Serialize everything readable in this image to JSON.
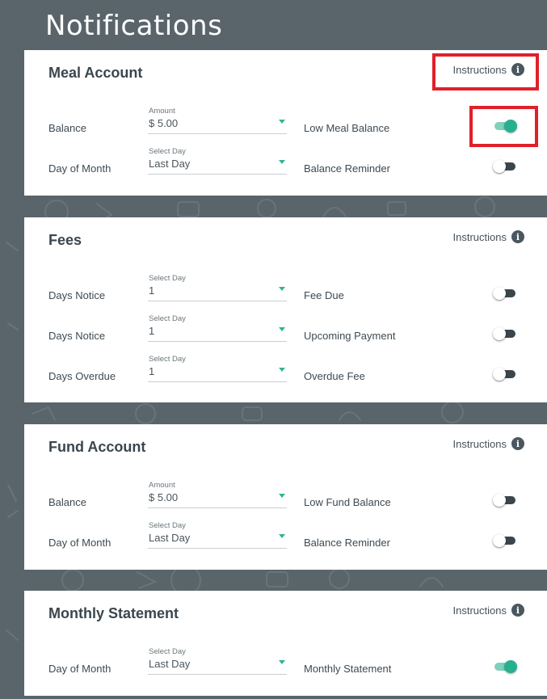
{
  "page": {
    "title": "Notifications"
  },
  "colors": {
    "accent": "#27b08f",
    "highlight": "#e0202a",
    "background": "#5a656b"
  },
  "icons": {
    "info": "info-icon",
    "caret": "caret-down-icon"
  },
  "meal": {
    "title": "Meal Account",
    "instructions": "Instructions",
    "rows": [
      {
        "label": "Balance",
        "field_label": "Amount",
        "field_value": "$ 5.00",
        "toggle_label": "Low Meal Balance",
        "toggle_on": true
      },
      {
        "label": "Day of Month",
        "field_label": "Select Day",
        "field_value": "Last Day",
        "toggle_label": "Balance Reminder",
        "toggle_on": false
      }
    ]
  },
  "fees": {
    "title": "Fees",
    "instructions": "Instructions",
    "rows": [
      {
        "label": "Days Notice",
        "field_label": "Select Day",
        "field_value": "1",
        "toggle_label": "Fee Due",
        "toggle_on": false
      },
      {
        "label": "Days Notice",
        "field_label": "Select Day",
        "field_value": "1",
        "toggle_label": "Upcoming Payment",
        "toggle_on": false
      },
      {
        "label": "Days Overdue",
        "field_label": "Select Day",
        "field_value": "1",
        "toggle_label": "Overdue Fee",
        "toggle_on": false
      }
    ]
  },
  "fund": {
    "title": "Fund Account",
    "instructions": "Instructions",
    "rows": [
      {
        "label": "Balance",
        "field_label": "Amount",
        "field_value": "$ 5.00",
        "toggle_label": "Low Fund Balance",
        "toggle_on": false
      },
      {
        "label": "Day of Month",
        "field_label": "Select Day",
        "field_value": "Last Day",
        "toggle_label": "Balance Reminder",
        "toggle_on": false
      }
    ]
  },
  "statement": {
    "title": "Monthly Statement",
    "instructions": "Instructions",
    "rows": [
      {
        "label": "Day of Month",
        "field_label": "Select Day",
        "field_value": "Last Day",
        "toggle_label": "Monthly Statement",
        "toggle_on": true
      }
    ]
  }
}
